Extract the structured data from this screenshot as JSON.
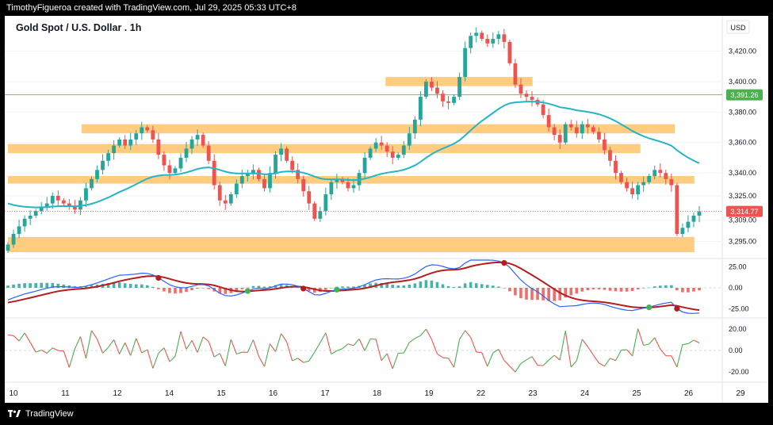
{
  "header": {
    "caption": "TimothyFigueroa created with TradingView.com, Jul 29, 2025 05:33 UTC+8"
  },
  "footer": {
    "brand": "TradingView"
  },
  "colors": {
    "up": "#26a69a",
    "down": "#ef5350",
    "zone": "#ffcc80",
    "ma": "#26b5c4",
    "price_line": "#ef5350",
    "level_line": "#4caf50",
    "macd_line": "#2962ff",
    "signal_line": "#b71c1c",
    "osc_up": "#4caf50",
    "osc_down": "#ef5350"
  },
  "chart_data": [
    {
      "type": "candlestick",
      "title": "Gold Spot / U.S. Dollar . 1h",
      "currency": "USD",
      "ylim": [
        3287,
        3440
      ],
      "yticks": [
        "3,295.00",
        "3,309.00",
        "3,325.00",
        "3,340.00",
        "3,360.00",
        "3,380.00",
        "3,400.00",
        "3,420.00"
      ],
      "ytick_values": [
        3295,
        3309,
        3325,
        3340,
        3360,
        3380,
        3400,
        3420
      ],
      "x_labels": [
        "10",
        "11",
        "12",
        "14",
        "15",
        "16",
        "17",
        "18",
        "19",
        "22",
        "23",
        "24",
        "25",
        "26",
        "29"
      ],
      "last_price": {
        "label": "3,314.77",
        "value": 3314.77
      },
      "level": {
        "label": "3,391.26",
        "value": 3391.26
      },
      "zones": [
        {
          "from": 3366,
          "to": 3372,
          "x_start": 1.5,
          "x_end": 13.6
        },
        {
          "from": 3353,
          "to": 3359,
          "x_start": 0,
          "x_end": 12.9
        },
        {
          "from": 3333,
          "to": 3338,
          "x_start": 0,
          "x_end": 14.0
        },
        {
          "from": 3288,
          "to": 3298,
          "x_start": 0,
          "x_end": 14.0
        },
        {
          "from": 3397,
          "to": 3403,
          "x_start": 7.7,
          "x_end": 10.7
        }
      ],
      "closes": [
        3293,
        3300,
        3305,
        3310,
        3312,
        3315,
        3318,
        3320,
        3325,
        3322,
        3320,
        3318,
        3316,
        3322,
        3330,
        3336,
        3342,
        3348,
        3353,
        3358,
        3362,
        3358,
        3362,
        3366,
        3370,
        3368,
        3362,
        3352,
        3345,
        3340,
        3343,
        3350,
        3356,
        3362,
        3365,
        3358,
        3348,
        3332,
        3322,
        3320,
        3326,
        3333,
        3338,
        3340,
        3342,
        3336,
        3330,
        3340,
        3352,
        3356,
        3348,
        3342,
        3336,
        3328,
        3320,
        3310,
        3315,
        3326,
        3334,
        3336,
        3334,
        3330,
        3332,
        3340,
        3350,
        3356,
        3360,
        3358,
        3354,
        3350,
        3352,
        3358,
        3366,
        3375,
        3390,
        3400,
        3396,
        3392,
        3387,
        3386,
        3390,
        3403,
        3422,
        3430,
        3432,
        3428,
        3425,
        3428,
        3431,
        3426,
        3412,
        3398,
        3392,
        3390,
        3388,
        3385,
        3378,
        3370,
        3365,
        3360,
        3372,
        3370,
        3366,
        3372,
        3370,
        3367,
        3362,
        3355,
        3348,
        3340,
        3334,
        3330,
        3326,
        3332,
        3334,
        3338,
        3342,
        3340,
        3336,
        3332,
        3300,
        3304,
        3308,
        3312,
        3314.77
      ]
    },
    {
      "type": "macd",
      "ylim": [
        -33,
        33
      ],
      "yticks": [
        "25.00",
        "0.00",
        "-25.00"
      ],
      "ytick_values": [
        25,
        0,
        -25
      ],
      "macd": [
        -14.4,
        -11.9,
        -9.5,
        -7.3,
        -5.7,
        -4.0,
        -2.1,
        -0.6,
        1.0,
        1.3,
        1.3,
        0.9,
        0.5,
        0.8,
        2.1,
        3.8,
        5.8,
        8.2,
        10.6,
        12.9,
        15.0,
        15.3,
        15.8,
        16.4,
        17.4,
        17.2,
        15.4,
        11.8,
        7.7,
        3.7,
        1.2,
        0.1,
        0.3,
        1.7,
        3.6,
        3.9,
        2.4,
        -1.9,
        -6.5,
        -9.2,
        -9.7,
        -8.5,
        -6.2,
        -3.8,
        -1.3,
        -0.4,
        -1.0,
        -0.1,
        2.3,
        4.3,
        4.5,
        3.7,
        2.0,
        -0.9,
        -4.5,
        -8.2,
        -8.5,
        -6.6,
        -4.0,
        -2.2,
        -1.2,
        -1.0,
        -0.5,
        1.1,
        3.8,
        6.8,
        9.3,
        10.6,
        10.8,
        10.6,
        10.5,
        11.4,
        13.3,
        16.4,
        21.1,
        25.4,
        27.3,
        27.1,
        25.5,
        23.5,
        22.6,
        24.0,
        29.4,
        33.0,
        33.0,
        33.0,
        33.0,
        32.8,
        31.9,
        29.6,
        24.3,
        16.6,
        9.3,
        3.6,
        -0.9,
        -4.8,
        -9.6,
        -14.9,
        -19.2,
        -22.4,
        -22.0,
        -21.5,
        -21.2,
        -19.7,
        -18.7,
        -18.1,
        -18.5,
        -19.9,
        -22.0,
        -23.9,
        -25.5,
        -26.7,
        -27.0,
        -25.6,
        -24.2,
        -23.2,
        -21.1,
        -19.4,
        -18.1,
        -17.1,
        -24.8,
        -28.7,
        -30.3,
        -30.5,
        -29.9
      ]
    },
    {
      "type": "oscillator",
      "ylim": [
        -28,
        28
      ],
      "yticks": [
        "20.00",
        "0.00",
        "-20.00"
      ],
      "ytick_values": [
        20,
        0,
        -20
      ],
      "values": [
        14.4,
        13.8,
        8.9,
        16.2,
        7.5,
        -1.6,
        0.4,
        -2.6,
        2.4,
        -0.1,
        -0.5,
        -15.8,
        1.5,
        12.9,
        -7.4,
        18.5,
        10.6,
        -2.5,
        2.8,
        10.0,
        -3.4,
        7.2,
        -4.7,
        11.3,
        -2.2,
        0.8,
        -16.6,
        -2.5,
        2.5,
        -10.4,
        -5.5,
        17.7,
        1.1,
        9.3,
        -1.9,
        12.6,
        8.4,
        -6.0,
        -2.7,
        -14.4,
        10.3,
        -3.3,
        -1.6,
        -1.7,
        9.9,
        -5.6,
        -14.9,
        6.1,
        -1.1,
        15.7,
        8.1,
        -9.6,
        -7.2,
        -11.2,
        -9.7,
        -1.6,
        7.3,
        16.4,
        -3.3,
        -0.3,
        1.7,
        6.1,
        4.5,
        10.8,
        -0.3,
        10.7,
        10.4,
        -9.4,
        -2.9,
        -17.0,
        -2.5,
        -2.3,
        7.5,
        11.2,
        13.8,
        19.8,
        10.2,
        -3.2,
        -6.7,
        -7.2,
        -15.7,
        10.3,
        18.6,
        12.1,
        -1.4,
        -2.0,
        -14.8,
        -2.2,
        1.1,
        -9.3,
        -14.6,
        -20.0,
        -12.1,
        -8.7,
        -5.7,
        -13.8,
        -14.0,
        -8.9,
        -4.5,
        -8.9,
        18.2,
        -15.5,
        -9.6,
        10.4,
        3.5,
        -4.3,
        -11.7,
        -14.6,
        -7.3,
        -9.4,
        0.3,
        0.7,
        -5.1,
        20.2,
        4.8,
        6.0,
        11.9,
        1.2,
        -4.9,
        -5.0,
        -15.4,
        5.5,
        6.2,
        9.6,
        7.0
      ]
    }
  ]
}
